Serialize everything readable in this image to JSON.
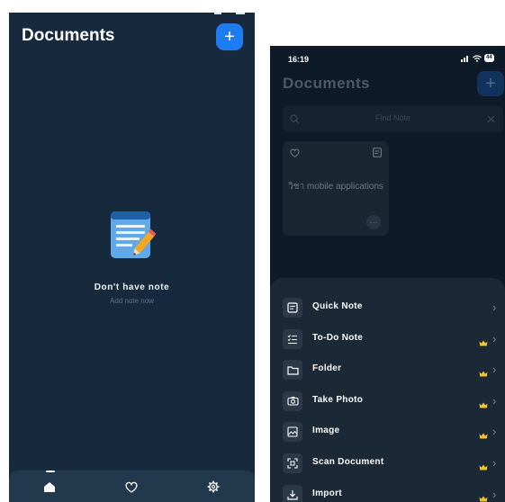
{
  "left_screen": {
    "title": "Documents",
    "add_icon": "plus-icon",
    "empty_state": {
      "icon": "notepad-pencil-icon",
      "title": "Don't have note",
      "subtitle": "Add note now"
    },
    "tabs": [
      {
        "name": "home",
        "icon": "home-icon",
        "active": true
      },
      {
        "name": "favorites",
        "icon": "heart-icon",
        "active": false
      },
      {
        "name": "settings",
        "icon": "gear-icon",
        "active": false
      }
    ]
  },
  "right_screen": {
    "time": "16:19",
    "battery": "44",
    "title": "Documents",
    "add_icon": "plus-icon",
    "search": {
      "placeholder": "Find Note"
    },
    "note_card": {
      "text": "วิชา mobile applications"
    },
    "menu": [
      {
        "label": "Quick Note",
        "icon": "note-icon",
        "premium": false
      },
      {
        "label": "To-Do Note",
        "icon": "checklist-icon",
        "premium": true
      },
      {
        "label": "Folder",
        "icon": "folder-icon",
        "premium": true
      },
      {
        "label": "Take Photo",
        "icon": "camera-icon",
        "premium": true
      },
      {
        "label": "Image",
        "icon": "image-icon",
        "premium": true
      },
      {
        "label": "Scan Document",
        "icon": "scan-icon",
        "premium": true
      },
      {
        "label": "Import",
        "icon": "import-icon",
        "premium": true
      }
    ],
    "colors": {
      "accent": "#1d7cf2",
      "crown": "#f2c230",
      "background": "#0e1a27",
      "sheet": "#1b2836"
    }
  }
}
